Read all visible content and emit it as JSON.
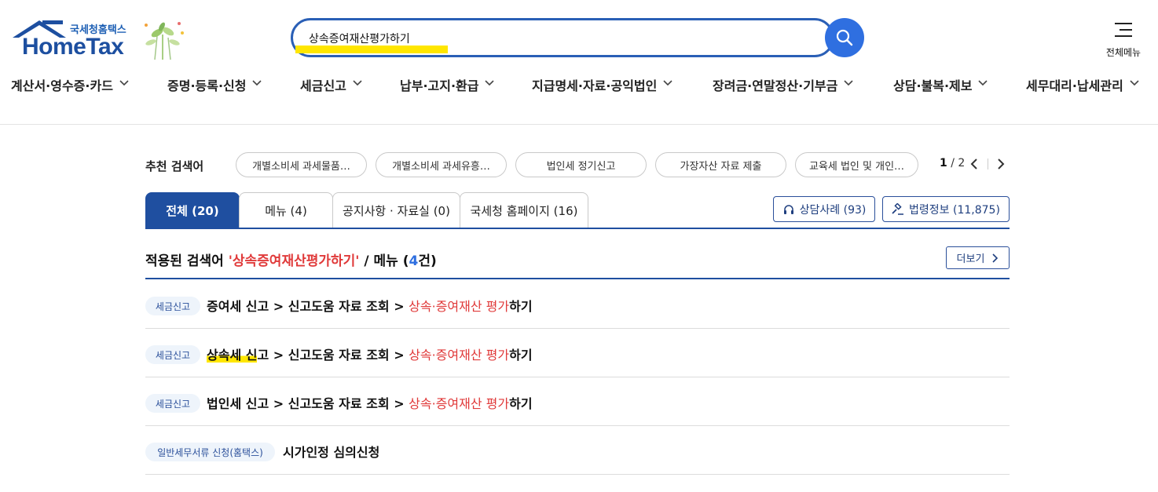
{
  "logo": {
    "sub": "국세청홈택스",
    "main": "HomeTax"
  },
  "search": {
    "value": "상속증여재산평가하기"
  },
  "all_menu": {
    "label": "전체메뉴"
  },
  "nav": [
    {
      "label": "계산서·영수증·카드"
    },
    {
      "label": "증명·등록·신청"
    },
    {
      "label": "세금신고"
    },
    {
      "label": "납부·고지·환급"
    },
    {
      "label": "지급명세·자료·공익법인"
    },
    {
      "label": "장려금·연말정산·기부금"
    },
    {
      "label": "상담·불복·제보"
    },
    {
      "label": "세무대리·납세관리"
    }
  ],
  "recommend": {
    "label": "추천 검색어",
    "chips": [
      "개별소비세 과세물품…",
      "개별소비세 과세유흥…",
      "법인세 정기신고",
      "가장자산 자료 제출",
      "교육세 법인 및 개인…"
    ],
    "page_current": "1",
    "page_sep": " / ",
    "page_total": "2"
  },
  "tabs": [
    {
      "label": "전체 (20)",
      "active": true
    },
    {
      "label": "메뉴 (4)"
    },
    {
      "label": "공지사항 · 자료실 (0)"
    },
    {
      "label": "국세청 홈페이지 (16)"
    }
  ],
  "side_buttons": {
    "counsel": "상담사례 (93)",
    "law": "법령정보 (11,875)"
  },
  "applied": {
    "prefix": "적용된 검색어 ",
    "keyword": "'상속증여재산평가하기'",
    "middle": " / 메뉴 (",
    "count": "4",
    "suffix": "건)"
  },
  "more_button": "더보기",
  "results": [
    {
      "tag": "세금신고",
      "first": "증여세 신고",
      "hl": "",
      "rest": "",
      "mid": " > 신고도움 자료 조회 > ",
      "red": "상속·증여재산 평가",
      "tail": "하기"
    },
    {
      "tag": "세금신고",
      "first": "",
      "hl": "상속세 신",
      "rest": "고",
      "mid": " > 신고도움 자료 조회 > ",
      "red": "상속·증여재산 평가",
      "tail": "하기"
    },
    {
      "tag": "세금신고",
      "first": "법인세 신고",
      "hl": "",
      "rest": "",
      "mid": " > 신고도움 자료 조회 > ",
      "red": "상속·증여재산 평가",
      "tail": "하기"
    },
    {
      "tag": "일반세무서류 신청(홈택스)",
      "first": "시가인정 심의신청",
      "hl": "",
      "rest": "",
      "mid": "",
      "red": "",
      "tail": ""
    }
  ],
  "colors": {
    "brand": "#1f4fa0",
    "accent": "#2f6fe0",
    "keyword": "#e03a3a",
    "highlight": "#ffe600"
  }
}
